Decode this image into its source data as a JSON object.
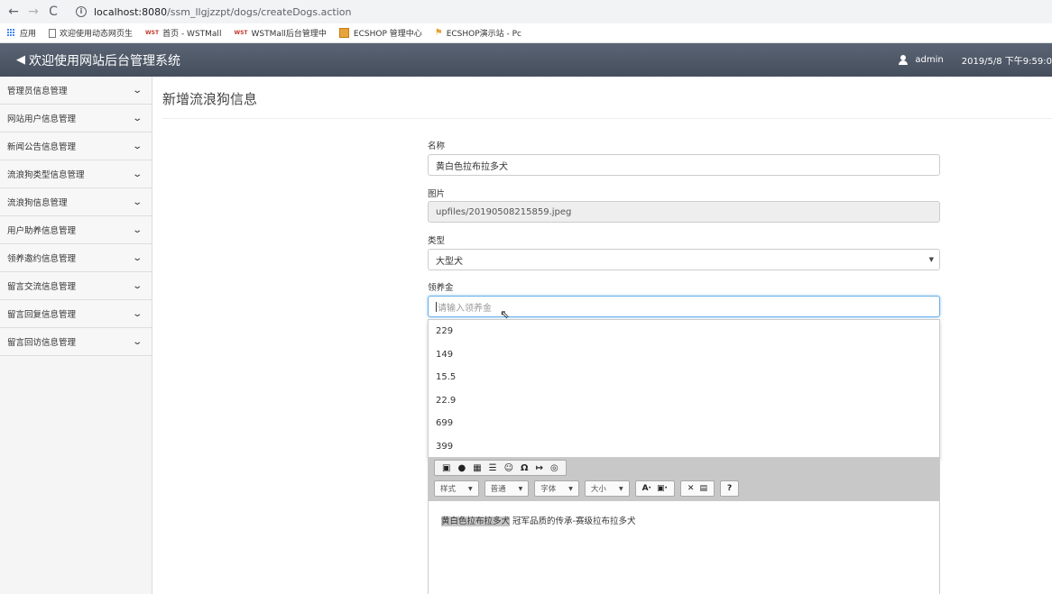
{
  "browser": {
    "url_host": "localhost:8080",
    "url_path": "/ssm_llgjzzpt/dogs/createDogs.action",
    "bookmarks": [
      "应用",
      "欢迎使用动态网页生",
      "首页 - WSTMall",
      "WSTMall后台管理中",
      "ECSHOP 管理中心",
      "ECSHOP演示站 - Pc"
    ]
  },
  "header": {
    "title": "欢迎使用网站后台管理系统",
    "user": "admin",
    "datetime": "2019/5/8 下午9:59:0"
  },
  "sidebar": {
    "items": [
      {
        "label": "管理员信息管理"
      },
      {
        "label": "网站用户信息管理"
      },
      {
        "label": "新闻公告信息管理"
      },
      {
        "label": "流浪狗类型信息管理"
      },
      {
        "label": "流浪狗信息管理"
      },
      {
        "label": "用户助养信息管理"
      },
      {
        "label": "领养邀约信息管理"
      },
      {
        "label": "留言交流信息管理"
      },
      {
        "label": "留言回复信息管理"
      },
      {
        "label": "留言回访信息管理"
      }
    ]
  },
  "main": {
    "page_title": "新增流浪狗信息",
    "form": {
      "name_label": "名称",
      "name_value": "黄白色拉布拉多犬",
      "image_label": "图片",
      "image_value": "upfiles/20190508215859.jpeg",
      "type_label": "类型",
      "type_value": "大型犬",
      "fee_label": "领养金",
      "fee_placeholder": "请输入领养金",
      "autocomplete_options": [
        "229",
        "149",
        "15.5",
        "22.9",
        "699",
        "399"
      ]
    },
    "editor": {
      "combos": [
        "样式",
        "普通",
        "字体",
        "大小"
      ],
      "content_highlight": "黄白色拉布拉多犬",
      "content_rest": " 冠军品质的传承-赛级拉布拉多犬"
    }
  }
}
